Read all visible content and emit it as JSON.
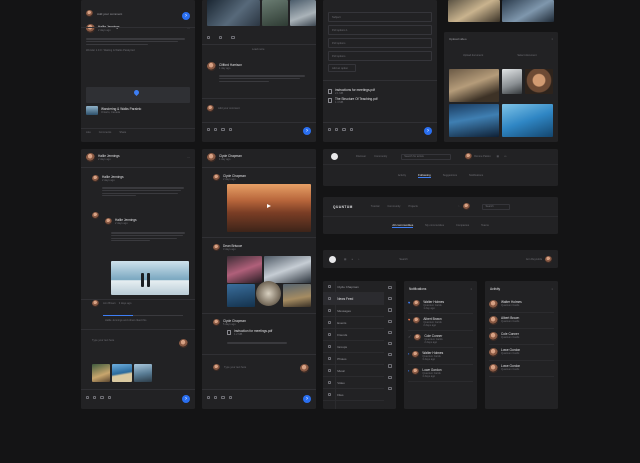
{
  "col1_top": {
    "add_comment_placeholder": "Add your comment",
    "author": "Hallie Jennings",
    "time": "2 days ago",
    "body1": "Ever wondered how some people seemingly always manage to produce beautiful photos that seem to be straight out of a travel magazine?",
    "body2": "Wondering by the Waterfalls.",
    "track": "Wonder 1.0.0 : Waiting & Walks Paralyzed",
    "location_title": "Wandering & Walks Paralelo",
    "location_sub": "Ontario, Canada",
    "like_label": "Like",
    "comments_label": "Comments",
    "share_label": "Share"
  },
  "col1_bottom": {
    "author": "Hallie Jennings",
    "time": "2 days ago",
    "body": "Here's how you can take amazing photos when you're on the road.",
    "reply_author": "Hallie Jennings",
    "reply_time": "2 days ago",
    "reply_body": "When you take your camera, make sure you don't forget to enjoy the journey and the scenery.",
    "commenter_time": "3 days ago",
    "commenter_name": "Ann Brown",
    "commenter_body": "Hallie Jennings and others liked this",
    "input_placeholder": "Type your text here"
  },
  "col2_top": {
    "post_author": "Clifford Harrison",
    "post_time": "1 day ago",
    "post_body": "During the last few years I've realized how important it is to capture the everyday moments.",
    "load_more": "Load more",
    "comment_placeholder": "Add your comment"
  },
  "col2_bottom": {
    "header_name": "Clyde Chapman",
    "header_time": "1 day ago",
    "post1_author": "Clyde Chapman",
    "post1_time": "2 days ago",
    "post2_author": "Dean Briscoe",
    "post2_time": "3 days ago",
    "post3_author": "Clyde Chapman",
    "post3_time": "5 days ago",
    "attachment": "instruction for meetings.pdf",
    "attachment_size": "1.2 MB",
    "input_placeholder": "Type your text here"
  },
  "col3_top": {
    "options": [
      "Subject",
      "Poll options 1",
      "Poll options",
      "Poll options"
    ],
    "add_option": "Add an option",
    "files": [
      {
        "name": "instructions for meetings.pdf",
        "size": "2.1 MB"
      },
      {
        "name": "The Structure Of Teaching.pdf",
        "size": "1.4 MB"
      }
    ]
  },
  "col4_top": {
    "upload_title": "Upload video",
    "upload_button": "Upload document",
    "select_button": "Select document"
  },
  "nav1": {
    "items": [
      "Discover",
      "Community",
      "Search for artists",
      "Dionne Patton"
    ],
    "tabs": [
      "Activity",
      "Following",
      "Suggestions",
      "Notifications"
    ]
  },
  "nav2": {
    "logo": "QUANTUM",
    "items": [
      "Tutorial",
      "Community",
      "Projects"
    ],
    "search_placeholder": "Search",
    "tabs": [
      "All communities",
      "My communities",
      "Companies",
      "Teams"
    ]
  },
  "nav3": {
    "search_placeholder": "Search",
    "user": "Ann Reynolds"
  },
  "sidebar_menu": {
    "items": [
      {
        "label": "Clyde Chapman",
        "badge": ""
      },
      {
        "label": "News Feed",
        "badge": "5"
      },
      {
        "label": "Messages",
        "badge": "14"
      },
      {
        "label": "Events",
        "badge": ""
      },
      {
        "label": "Friends",
        "badge": ""
      },
      {
        "label": "Groups",
        "badge": ""
      },
      {
        "label": "Photos",
        "badge": ""
      },
      {
        "label": "Music",
        "badge": ""
      },
      {
        "label": "Video",
        "badge": ""
      },
      {
        "label": "Files",
        "badge": ""
      }
    ]
  },
  "notifications": {
    "title": "Notifications",
    "items": [
      {
        "name": "Walter Holmes",
        "text": "Quantum Cards",
        "time": "1 day ago"
      },
      {
        "name": "Albert Brown",
        "text": "Quantum Cards",
        "time": "2 days ago"
      },
      {
        "name": "Cole Conner",
        "text": "Quantum Cards",
        "time": "2 days ago"
      },
      {
        "name": "Walter Holmes",
        "text": "Quantum Cards",
        "time": "3 days ago"
      },
      {
        "name": "Lowe Gordon",
        "text": "Quantum Cards",
        "time": "4 days ago"
      }
    ]
  },
  "activity": {
    "title": "Activity",
    "items": [
      {
        "name": "Walter Holmes",
        "text": "Quantum Cards"
      },
      {
        "name": "Albert Brown",
        "text": "Quantum Cards"
      },
      {
        "name": "Cole Conner",
        "text": "Quantum Cards"
      },
      {
        "name": "Lowe Gordon",
        "text": "Quantum Cards"
      },
      {
        "name": "Lowe Gordon",
        "text": "Quantum Cards"
      }
    ]
  },
  "colors": {
    "background": "#141415",
    "panel": "#222224",
    "accent": "#2a6ff0"
  }
}
